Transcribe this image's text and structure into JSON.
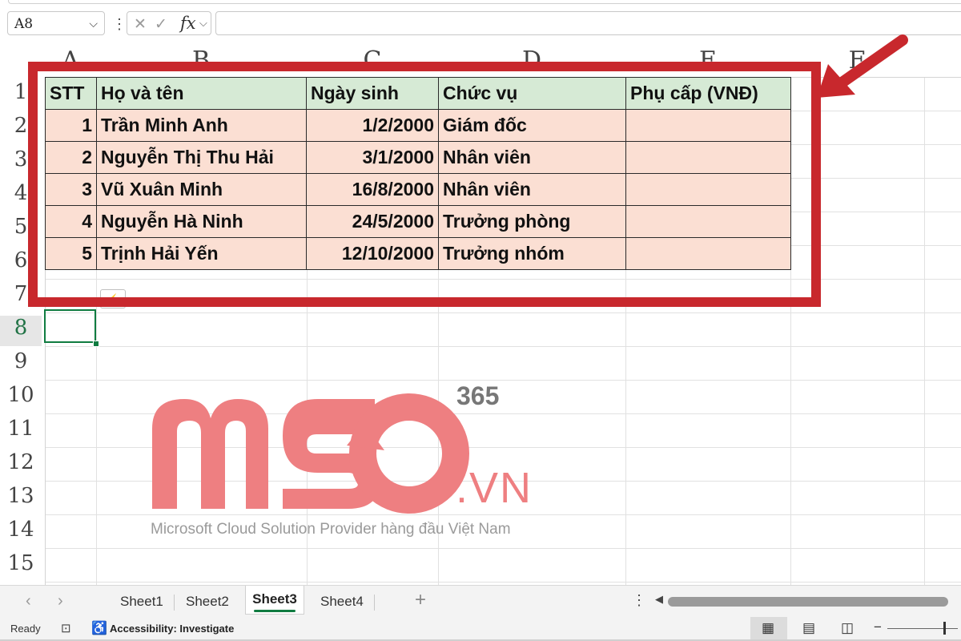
{
  "formula_bar": {
    "name_box": "A8",
    "chevron": "⌵",
    "separator": "⋮",
    "cancel_icon": "✕",
    "confirm_icon": "✓",
    "fx_label": "fx",
    "formula_value": ""
  },
  "columns": [
    "A",
    "B",
    "C",
    "D",
    "E",
    "F"
  ],
  "rows": [
    "1",
    "2",
    "3",
    "4",
    "5",
    "6",
    "7",
    "8",
    "9",
    "10",
    "11",
    "12",
    "13",
    "14",
    "15"
  ],
  "active_row": "8",
  "table": {
    "headers": [
      "STT",
      "Họ và tên",
      "Ngày sinh",
      "Chức vụ",
      "Phụ cấp (VNĐ)"
    ],
    "records": [
      [
        "1",
        "Trần Minh Anh",
        "1/2/2000",
        "Giám đốc",
        ""
      ],
      [
        "2",
        "Nguyễn Thị Thu Hải",
        "3/1/2000",
        "Nhân viên",
        ""
      ],
      [
        "3",
        "Vũ Xuân Minh",
        "16/8/2000",
        "Nhân viên",
        ""
      ],
      [
        "4",
        "Nguyễn Hà Ninh",
        "24/5/2000",
        "Trưởng phòng",
        ""
      ],
      [
        "5",
        "Trịnh Hải Yến",
        "12/10/2000",
        "Trưởng nhóm",
        ""
      ]
    ]
  },
  "watermark": {
    "logo": "MSO",
    "suffix": ".VN",
    "superscript": "365",
    "tagline": "Microsoft Cloud Solution Provider hàng đầu Việt Nam"
  },
  "sheet_tabs": {
    "tabs": [
      "Sheet1",
      "Sheet2",
      "Sheet3",
      "Sheet4"
    ],
    "active": "Sheet3",
    "prev_icon": "‹",
    "next_icon": "›",
    "add_icon": "+",
    "more_icon": "⋮",
    "scroll_left_icon": "◀"
  },
  "status_bar": {
    "ready": "Ready",
    "accessibility": "Accessibility: Investigate",
    "zoom_minus": "−",
    "macro_icon": "⊡",
    "accessibility_icon": "♿",
    "normal_view_icon": "▦",
    "page_layout_icon": "▤",
    "page_break_icon": "◫"
  },
  "colors": {
    "header_fill": "#d6ead5",
    "body_fill": "#fbdfd3",
    "annotation": "#c8282d",
    "logo": "#ee7f81",
    "selection": "#107c41"
  }
}
